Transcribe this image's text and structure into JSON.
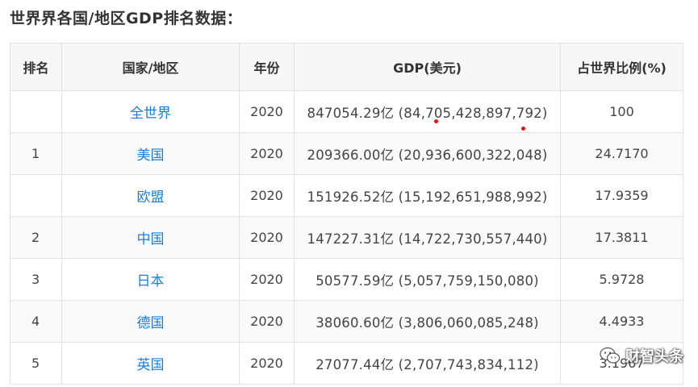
{
  "title": "世界界各国/地区GDP排名数据：",
  "table": {
    "headers": [
      "排名",
      "国家/地区",
      "年份",
      "GDP(美元)",
      "占世界比例(%)"
    ],
    "rows": [
      {
        "rank": "",
        "country": "全世界",
        "year": "2020",
        "gdp": "847054.29亿 (84,705,428,897,792)",
        "share": "100"
      },
      {
        "rank": "1",
        "country": "美国",
        "year": "2020",
        "gdp": "209366.00亿 (20,936,600,322,048)",
        "share": "24.7170"
      },
      {
        "rank": "",
        "country": "欧盟",
        "year": "2020",
        "gdp": "151926.52亿 (15,192,651,988,992)",
        "share": "17.9359"
      },
      {
        "rank": "2",
        "country": "中国",
        "year": "2020",
        "gdp": "147227.31亿 (14,722,730,557,440)",
        "share": "17.3811"
      },
      {
        "rank": "3",
        "country": "日本",
        "year": "2020",
        "gdp": "50577.59亿 (5,057,759,150,080)",
        "share": "5.9728"
      },
      {
        "rank": "4",
        "country": "德国",
        "year": "2020",
        "gdp": "38060.60亿 (3,806,060,085,248)",
        "share": "4.4933"
      },
      {
        "rank": "5",
        "country": "英国",
        "year": "2020",
        "gdp": "27077.44亿 (2,707,743,834,112)",
        "share": "3.1967"
      }
    ]
  },
  "watermark": {
    "text": "财智头条",
    "icon": "wechat-icon"
  },
  "colors": {
    "link": "#1a7ee0",
    "header_bg": "#f7f7f7",
    "border": "#e2e2e2",
    "mark": "#e8101a"
  }
}
